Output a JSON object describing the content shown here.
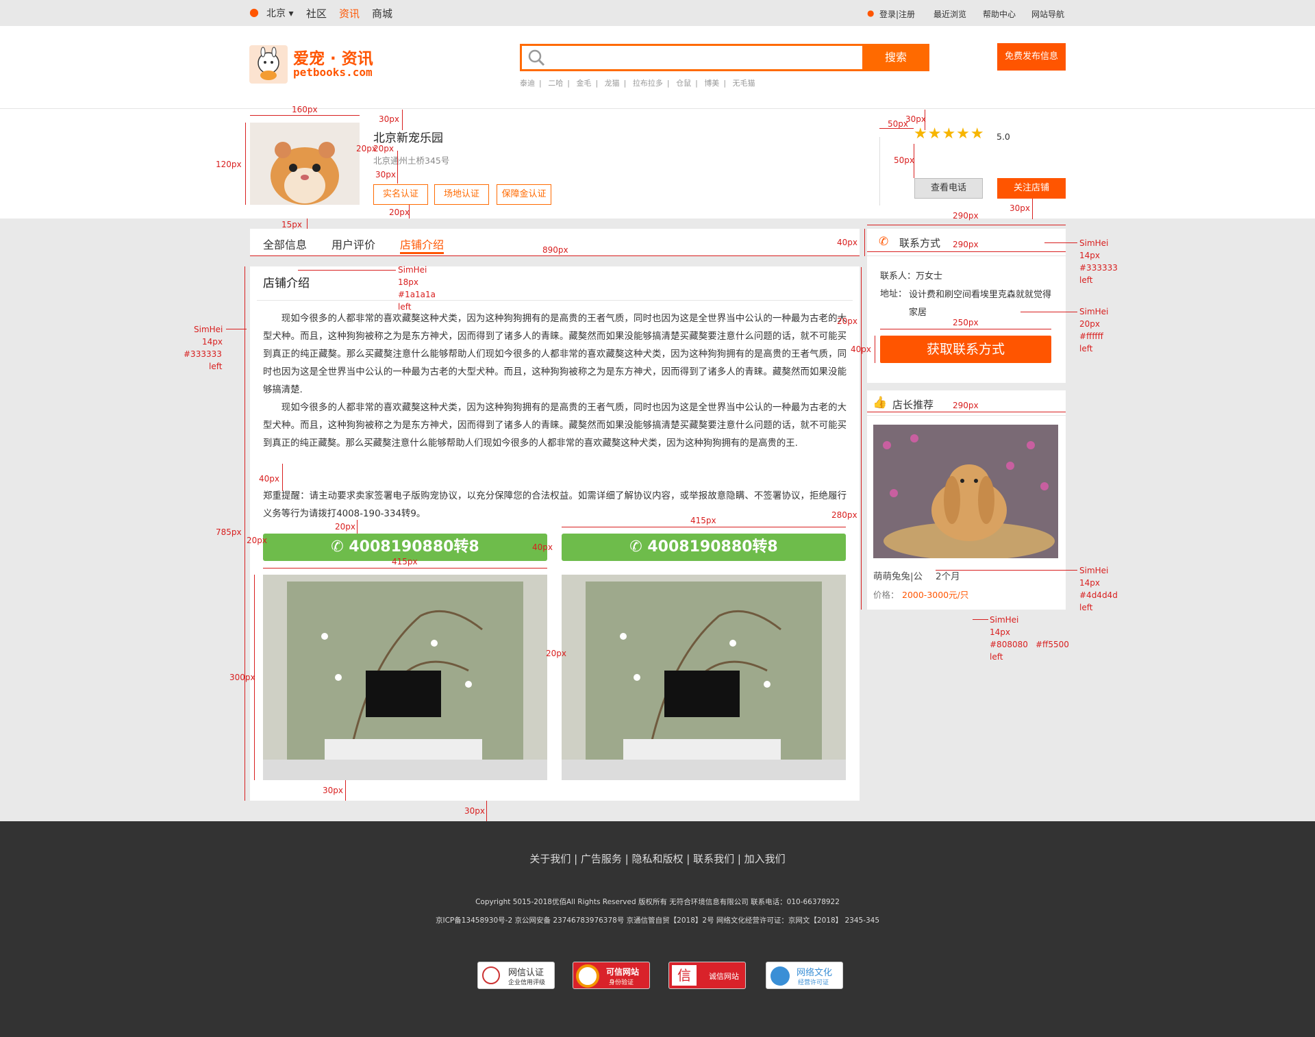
{
  "topbar": {
    "city": "北京",
    "nav": [
      "社区",
      "资讯",
      "商城"
    ],
    "login": "登录|注册",
    "links": [
      "最近浏览",
      "帮助中心",
      "网站导航"
    ]
  },
  "header": {
    "logo_cn": "爱宠 · 资讯",
    "logo_en": "petbooks.com",
    "search_btn": "搜索",
    "publish": "免费发布信息",
    "hot": [
      "泰迪",
      "二哈",
      "金毛",
      "龙猫",
      "拉布拉多",
      "仓鼠",
      "博美",
      "无毛猫"
    ]
  },
  "shop": {
    "name": "北京新宠乐园",
    "address": "北京通州土桥345号",
    "badges": [
      "实名认证",
      "场地认证",
      "保障金认证"
    ],
    "rating": "5.0",
    "phone_btn": "查看电话",
    "follow_btn": "关注店铺"
  },
  "tabs": [
    "全部信息",
    "用户评价",
    "店铺介绍"
  ],
  "intro": {
    "title": "店铺介绍",
    "p1": "现如今很多的人都非常的喜欢藏獒这种犬类，因为这种狗狗拥有的是高贵的王者气质，同时也因为这是全世界当中公认的一种最为古老的大型犬种。而且，这种狗狗被称之为是东方神犬，因而得到了诸多人的青睐。藏獒然而如果没能够搞清楚买藏獒要注意什么问题的话，就不可能买到真正的纯正藏獒。那么买藏獒注意什么能够帮助人们现如今很多的人都非常的喜欢藏獒这种犬类，因为这种狗狗拥有的是高贵的王者气质，同时也因为这是全世界当中公认的一种最为古老的大型犬种。而且，这种狗狗被称之为是东方神犬，因而得到了诸多人的青睐。藏獒然而如果没能够搞清楚.",
    "p2": "现如今很多的人都非常的喜欢藏獒这种犬类，因为这种狗狗拥有的是高贵的王者气质，同时也因为这是全世界当中公认的一种最为古老的大型犬种。而且，这种狗狗被称之为是东方神犬，因而得到了诸多人的青睐。藏獒然而如果没能够搞清楚买藏獒要注意什么问题的话，就不可能买到真正的纯正藏獒。那么买藏獒注意什么能够帮助人们现如今很多的人都非常的喜欢藏獒这种犬类，因为这种狗狗拥有的是高贵的王.",
    "notice": "郑重提醒：请主动要求卖家签署电子版购宠协议，以充分保障您的合法权益。如需详细了解协议内容，或举报故意隐瞒、不签署协议，拒绝履行义务等行为请拨打4008-190-334转9。",
    "phone": "4008190880转8"
  },
  "contact": {
    "title": "联系方式",
    "person": "联系人：万女士",
    "address_label": "地址：",
    "address": "设计费和刷空间看埃里克森就就觉得家居",
    "btn": "获取联系方式"
  },
  "recommend": {
    "title": "店长推荐",
    "name": "萌萌兔兔|公",
    "age": "2个月",
    "price_label": "价格：",
    "price": "2000-3000元/只"
  },
  "annotations": {
    "w160": "160px",
    "h30a": "30px",
    "h20a": "20px",
    "h20b": "20px",
    "h30b": "30px",
    "h120": "120px",
    "h20c": "20px",
    "h15": "15px",
    "w50a": "50px",
    "h30c": "30px",
    "h50": "50px",
    "w290a": "290px",
    "h30d": "30px",
    "h40a": "40px",
    "w890": "890px",
    "w290b": "290px",
    "simhei": "SimHei",
    "f18": "18px",
    "c1a": "#1a1a1a",
    "left": "left",
    "f14": "14px",
    "c333": "#333333",
    "f20": "20px",
    "cfff": "#ffffff",
    "h20d": "20px",
    "w250": "250px",
    "h40b": "40px",
    "w290c": "290px",
    "h785": "785px",
    "h40c": "40px",
    "h20e": "20px",
    "w20a": "20px",
    "h40d": "40px",
    "w415a": "415px",
    "w415b": "415px",
    "h280": "280px",
    "w20b": "20px",
    "h300": "300px",
    "h30e": "30px",
    "h30f": "30px",
    "c4d": "#4d4d4d",
    "c808": "#808080",
    "cf55": "#ff5500"
  },
  "footer": {
    "links": "关于我们 | 广告服务 | 隐私和版权 | 联系我们 | 加入我们",
    "copyright": "Copyright  5015-2018优佰All Rights Reserved 版权所有  无符合环境信息有限公司   联系电话：010-66378922",
    "icp": "京ICP备13458930号-2            京公网安备 23746783976378号            京通信管自贸【2018】2号            网络文化经营许可证：京网文【2018】 2345-345",
    "badges": [
      {
        "t1": "网信认证",
        "t2": "企业信用评级"
      },
      {
        "t1": "可信网站",
        "t2": "身份验证"
      },
      {
        "t1": "诚信网站",
        "t2": ""
      },
      {
        "t1": "网络文化",
        "t2": "经营许可证"
      }
    ]
  },
  "colors": {
    "orange": "#ff5500",
    "green": "#6ebc4b",
    "annotation": "#d81e1e",
    "footer": "#333333"
  }
}
